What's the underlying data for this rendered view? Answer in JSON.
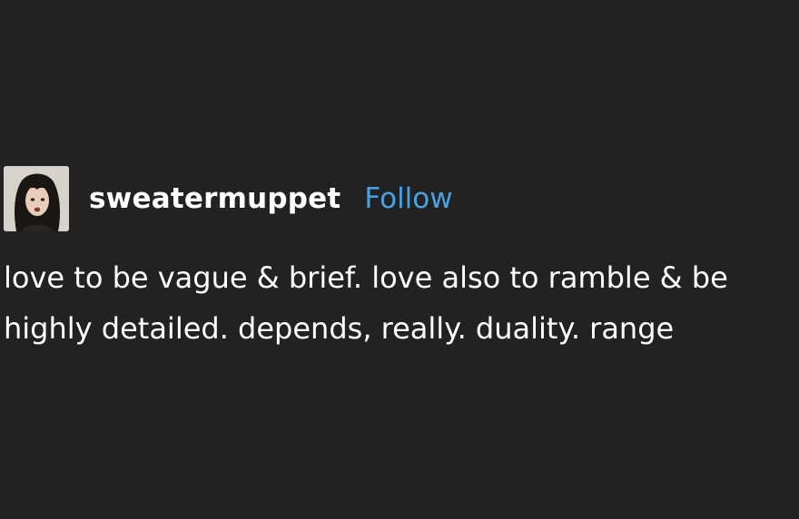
{
  "post": {
    "avatar_icon": "user-avatar",
    "username": "sweatermuppet",
    "follow_label": "Follow",
    "body_line_1": "love to be vague & brief. love also to ramble & be",
    "body_line_2": "highly detailed. depends, really. duality. range"
  },
  "colors": {
    "background": "#222222",
    "text": "#ffffff",
    "follow_link": "#4ba2e3"
  }
}
